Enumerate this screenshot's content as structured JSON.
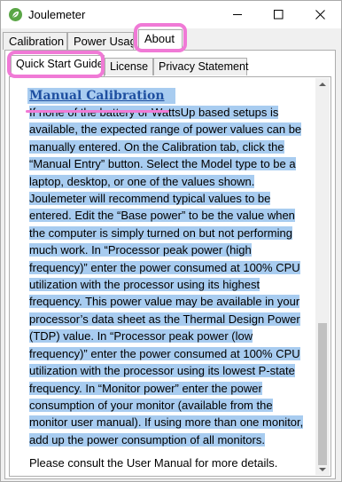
{
  "window": {
    "title": "Joulemeter",
    "app_icon": "joulemeter-leaf-icon",
    "controls": [
      "minimize-icon",
      "maximize-icon",
      "close-icon"
    ]
  },
  "main_tabs": [
    "Calibration",
    "Power Usage",
    "About"
  ],
  "about_tabs": [
    "Quick Start Guide",
    "License",
    "Privacy Statement"
  ],
  "guide": {
    "heading": "Manual Calibration",
    "paragraph": "If none of the battery or WattsUp based setups is available, the expected range of power values can be manually entered. On the Calibration tab, click the “Manual Entry” button. Select the Model type to be a laptop, desktop, or one of the values shown. Joulemeter will recommend typical values to be entered. Edit the “Base power” to be the value when the computer is simply turned on but not performing much work. In “Processor peak power (high frequency)” enter the power consumed at 100% CPU utilization with the processor using its highest frequency. This power value may be available in your processor’s data sheet as the Thermal Design Power (TDP) value. In “Processor peak power (low frequency)” enter the power consumed at 100% CPU utilization with the processor using its lowest P-state frequency. In “Monitor power” enter the power consumption of your monitor (available from the monitor user manual). If using more than one monitor, add up the power consumption of all monitors.",
    "note": "Please consult the User Manual for more details."
  },
  "colors": {
    "highlight": "#a8ccf0",
    "heading": "#1e4fa0",
    "annotation": "#f07ad6"
  }
}
